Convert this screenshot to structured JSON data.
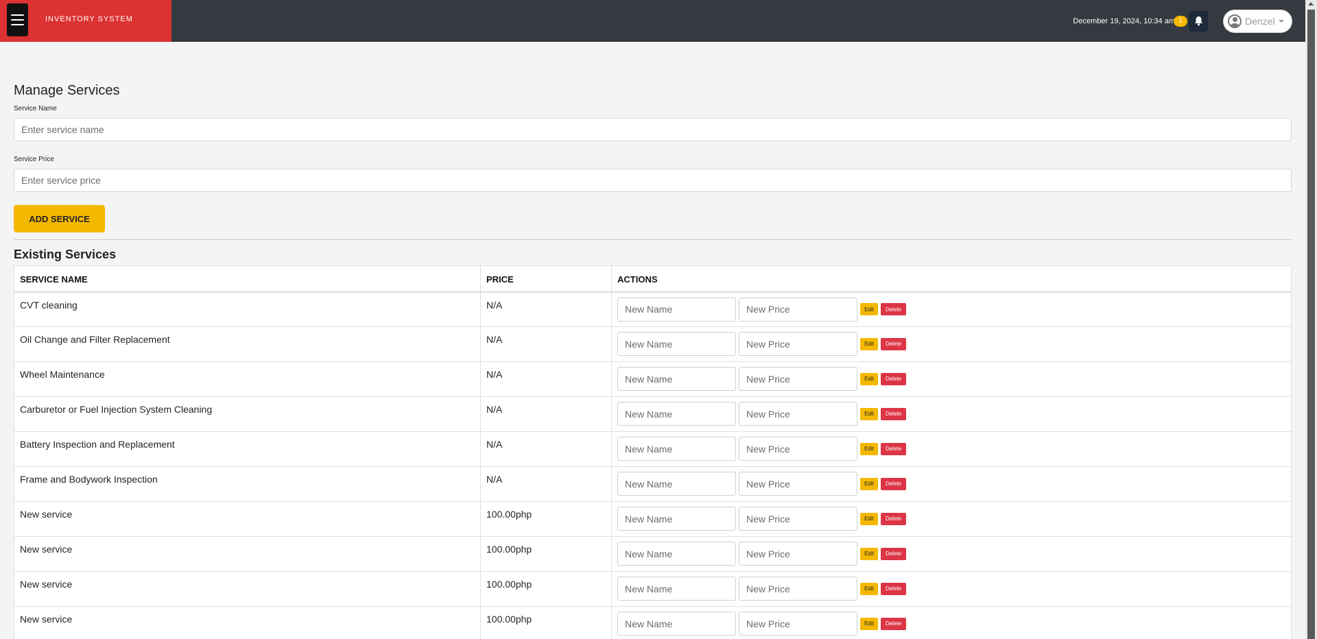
{
  "header": {
    "brand": "INVENTORY SYSTEM",
    "datetime": "December 19, 2024, 10:34 am",
    "notification_count": "1",
    "user_name": "Denzel"
  },
  "form": {
    "title": "Manage Services",
    "name_label": "Service Name",
    "name_placeholder": "Enter service name",
    "price_label": "Service Price",
    "price_placeholder": "Enter service price",
    "add_button": "ADD SERVICE"
  },
  "services": {
    "title": "Existing Services",
    "columns": [
      "SERVICE NAME",
      "PRICE",
      "ACTIONS"
    ],
    "rows": [
      {
        "name": "CVT cleaning",
        "price": "N/A"
      },
      {
        "name": "Oil Change and Filter Replacement",
        "price": "N/A"
      },
      {
        "name": "Wheel Maintenance",
        "price": "N/A"
      },
      {
        "name": "Carburetor or Fuel Injection System Cleaning",
        "price": "N/A"
      },
      {
        "name": "Battery Inspection and Replacement",
        "price": "N/A"
      },
      {
        "name": "Frame and Bodywork Inspection",
        "price": "N/A"
      },
      {
        "name": "New service",
        "price": "100.00php"
      },
      {
        "name": "New service",
        "price": "100.00php"
      },
      {
        "name": "New service",
        "price": "100.00php"
      },
      {
        "name": "New service",
        "price": "100.00php"
      }
    ],
    "row_actions": {
      "new_name_placeholder": "New Name",
      "new_price_placeholder": "New Price",
      "edit_label": "Edit",
      "delete_label": "Delete"
    }
  },
  "colors": {
    "brand_red": "#dc3232",
    "topbar": "#343a40",
    "accent_yellow": "#f5b800",
    "danger": "#dc3545"
  },
  "icons": [
    "menu-icon",
    "bell-icon",
    "user-avatar-icon",
    "caret-down-icon"
  ]
}
